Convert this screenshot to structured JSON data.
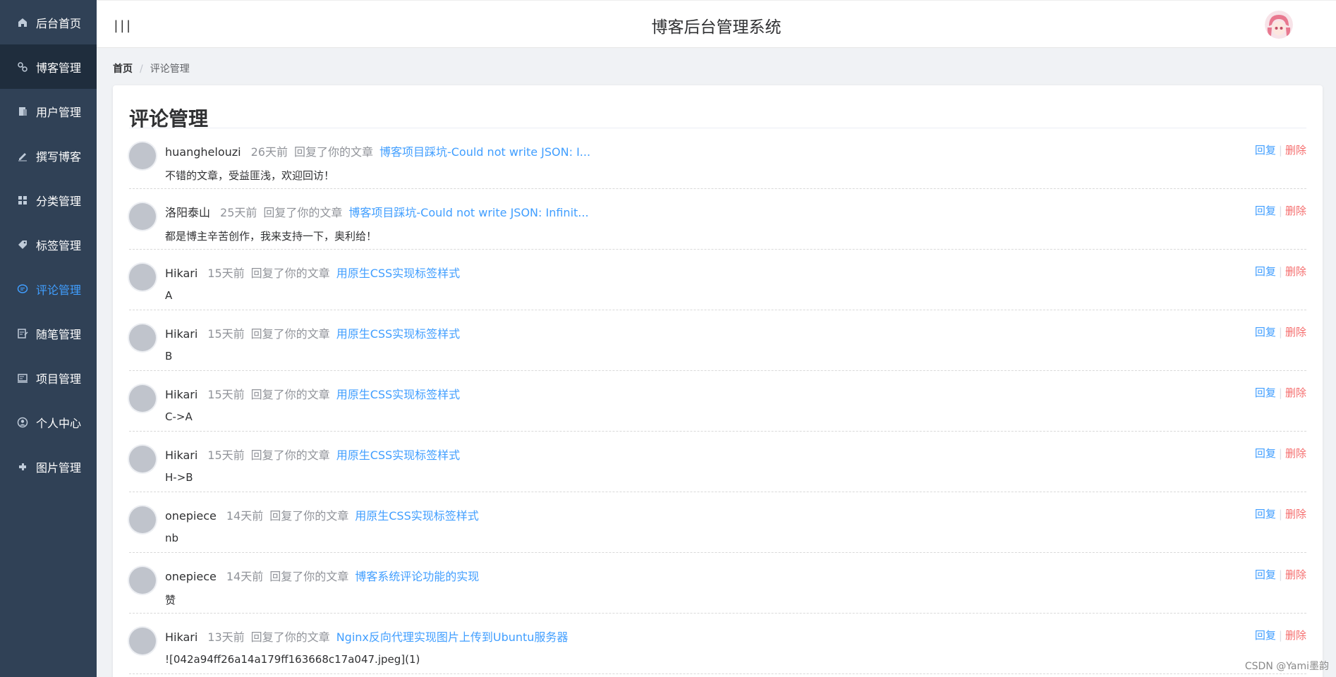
{
  "sidebar": {
    "items": [
      {
        "label": "后台首页",
        "icon": "home-icon"
      },
      {
        "label": "博客管理",
        "icon": "blog-icon"
      },
      {
        "label": "用户管理",
        "icon": "users-icon"
      },
      {
        "label": "撰写博客",
        "icon": "edit-icon"
      },
      {
        "label": "分类管理",
        "icon": "grid-icon"
      },
      {
        "label": "标签管理",
        "icon": "tag-icon"
      },
      {
        "label": "评论管理",
        "icon": "comment-icon"
      },
      {
        "label": "随笔管理",
        "icon": "note-icon"
      },
      {
        "label": "项目管理",
        "icon": "project-icon"
      },
      {
        "label": "个人中心",
        "icon": "user-circle-icon"
      },
      {
        "label": "图片管理",
        "icon": "image-icon"
      }
    ],
    "active_index": 6,
    "active_color": "#409eff"
  },
  "header": {
    "toggle": "|||",
    "title": "博客后台管理系统"
  },
  "breadcrumb": {
    "home": "首页",
    "separator": "/",
    "current": "评论管理"
  },
  "main": {
    "title": "评论管理",
    "action_text": "回复了你的文章",
    "reply_label": "回复",
    "op_separator": "|",
    "delete_label": "删除",
    "comments": [
      {
        "user": "huanghelouzi",
        "time": "26天前",
        "article": "博客项目踩坑-Could not write JSON: I...",
        "content": "不错的文章，受益匪浅，欢迎回访！"
      },
      {
        "user": "洛阳泰山",
        "time": "25天前",
        "article": "博客项目踩坑-Could not write JSON: Infinit...",
        "content": "都是博主辛苦创作，我来支持一下，奥利给！"
      },
      {
        "user": "Hikari",
        "time": "15天前",
        "article": "用原生CSS实现标签样式",
        "content": "A"
      },
      {
        "user": "Hikari",
        "time": "15天前",
        "article": "用原生CSS实现标签样式",
        "content": "B"
      },
      {
        "user": "Hikari",
        "time": "15天前",
        "article": "用原生CSS实现标签样式",
        "content": "C->A"
      },
      {
        "user": "Hikari",
        "time": "15天前",
        "article": "用原生CSS实现标签样式",
        "content": "H->B"
      },
      {
        "user": "onepiece",
        "time": "14天前",
        "article": "用原生CSS实现标签样式",
        "content": "nb"
      },
      {
        "user": "onepiece",
        "time": "14天前",
        "article": "博客系统评论功能的实现",
        "content": "赞"
      },
      {
        "user": "Hikari",
        "time": "13天前",
        "article": "Nginx反向代理实现图片上传到Ubuntu服务器",
        "content": "![042a94ff26a14a179ff163668c17a047.jpeg](1)"
      }
    ]
  },
  "watermark": "CSDN @Yami墨韵",
  "colors": {
    "sidebar_bg": "#304156",
    "link": "#409eff",
    "danger": "#f56c6c"
  }
}
